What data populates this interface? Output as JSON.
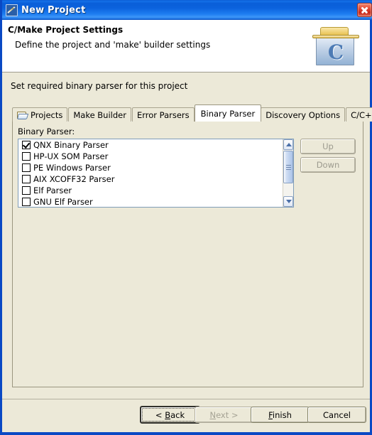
{
  "window": {
    "title": "New Project",
    "title_icon": "wizard-wand-icon",
    "close_label": "✕"
  },
  "header": {
    "title": "C/Make Project Settings",
    "subtitle": "Define the project and 'make' builder settings",
    "icon": "c-project-folder-icon",
    "icon_letter": "C"
  },
  "body": {
    "intro": "Set required binary parser for this project"
  },
  "tabs": [
    {
      "label": "Projects",
      "icon": "folder-icon",
      "selected": false
    },
    {
      "label": "Make Builder",
      "icon": "",
      "selected": false
    },
    {
      "label": "Error Parsers",
      "icon": "",
      "selected": false
    },
    {
      "label": "Binary Parser",
      "icon": "",
      "selected": true
    },
    {
      "label": "Discovery Options",
      "icon": "",
      "selected": false
    },
    {
      "label": "C/C++ Indexer",
      "icon": "",
      "selected": false
    }
  ],
  "panel": {
    "field_label": "Binary Parser:",
    "items": [
      {
        "label": "QNX Binary Parser",
        "checked": true
      },
      {
        "label": "HP-UX SOM Parser",
        "checked": false
      },
      {
        "label": "PE Windows Parser",
        "checked": false
      },
      {
        "label": "AIX XCOFF32 Parser",
        "checked": false
      },
      {
        "label": "Elf Parser",
        "checked": false
      },
      {
        "label": "GNU Elf Parser",
        "checked": false
      }
    ],
    "side_buttons": [
      {
        "label": "Up",
        "enabled": false
      },
      {
        "label": "Down",
        "enabled": false
      }
    ],
    "scrollbar": {
      "up_arrow": "chevron-up-icon",
      "down_arrow": "chevron-down-icon"
    }
  },
  "footer": {
    "back": {
      "label": "< Back",
      "mnemonic": "B",
      "enabled": true,
      "default": true
    },
    "next": {
      "label": "Next >",
      "mnemonic": "N",
      "enabled": false,
      "default": false
    },
    "finish": {
      "label": "Finish",
      "mnemonic": "F",
      "enabled": true,
      "default": false
    },
    "cancel": {
      "label": "Cancel",
      "mnemonic": "",
      "enabled": true,
      "default": false
    }
  },
  "colors": {
    "dialog_bg": "#ece9d8",
    "title_blue": "#0a5ed8",
    "frame_blue": "#0a49c4",
    "close_red": "#c6281a",
    "accent_c": "#4d7bb5"
  }
}
